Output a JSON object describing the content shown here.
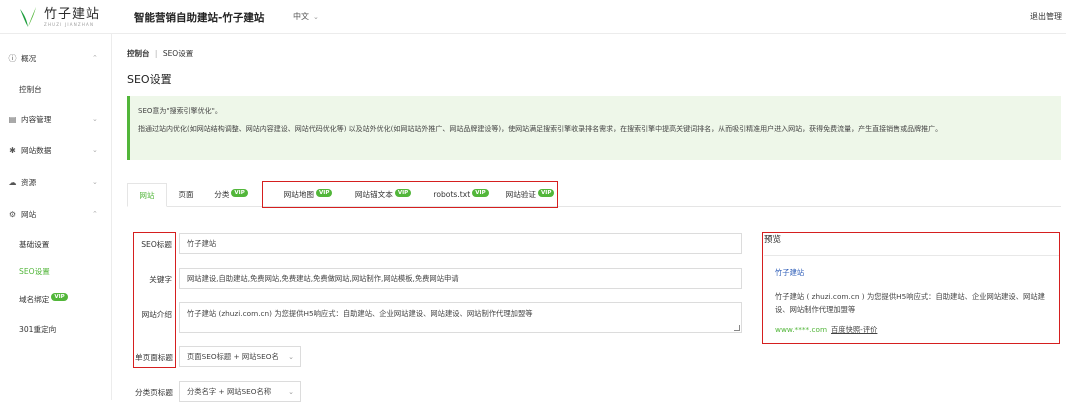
{
  "colors": {
    "accent": "#52b63a",
    "highlight_box": "#d51f1f",
    "notice_bg": "#eef7e9"
  },
  "header": {
    "logo_name": "竹子建站",
    "logo_sub": "ZHUZI JIANZHAN",
    "site_title": "智能营销自助建站-竹子建站",
    "language": "中文",
    "logout": "退出管理"
  },
  "sidebar": {
    "overview": "概况",
    "dashboard": "控制台",
    "content": "内容管理",
    "site_data": "网站数据",
    "resources": "资源",
    "site": "网站",
    "basic_settings": "基础设置",
    "seo_settings": "SEO设置",
    "domain_binding": "域名绑定",
    "redirect_301": "301重定向",
    "vip": "VIP"
  },
  "breadcrumb": {
    "root": "控制台",
    "sep": "|",
    "current": "SEO设置"
  },
  "page_title": "SEO设置",
  "notice": {
    "line1": "SEO意为\"搜索引擎优化\"。",
    "line2": "指通过站内优化(如网站结构调整、网站内容建设、网站代码优化等) 以及站外优化(如网站站外推广、网站品牌建设等)，使网站满足搜索引擎收录排名需求，在搜索引擎中提高关键词排名，从而吸引精准用户进入网站，获得免费流量，产生直接销售或品牌推广。"
  },
  "tabs": {
    "site": "网站",
    "page": "页面",
    "category": "分类",
    "sitemap": "网站地图",
    "anchor_text": "网站锚文本",
    "robots": "robots.txt",
    "verify": "网站验证",
    "vip": "VIP"
  },
  "form": {
    "seo_title_label": "SEO标题",
    "seo_title_value": "竹子建站",
    "keywords_label": "关键字",
    "keywords_value": "网站建设,自助建站,免费网站,免费建站,免费做网站,网站制作,网站模板,免费网站申请",
    "intro_label": "网站介绍",
    "intro_value": "竹子建站 (zhuzi.com.cn) 为您提供H5响应式：自助建站、企业网站建设、网站建设、网站制作代理加盟等",
    "page_title_label": "单页面标题",
    "page_title_value": "页面SEO标题 + 网站SEO名",
    "category_title_label": "分类页标题",
    "category_title_value": "分类名字 + 网站SEO名称"
  },
  "preview": {
    "title": "预览",
    "link": "竹子建站",
    "desc": "竹子建站 ( zhuzi.com.cn ) 为您提供H5响应式：自助建站、企业网站建设、网站建设、网站制作代理加盟等",
    "url": "www.****.com",
    "cache": "百度快照-评价"
  }
}
